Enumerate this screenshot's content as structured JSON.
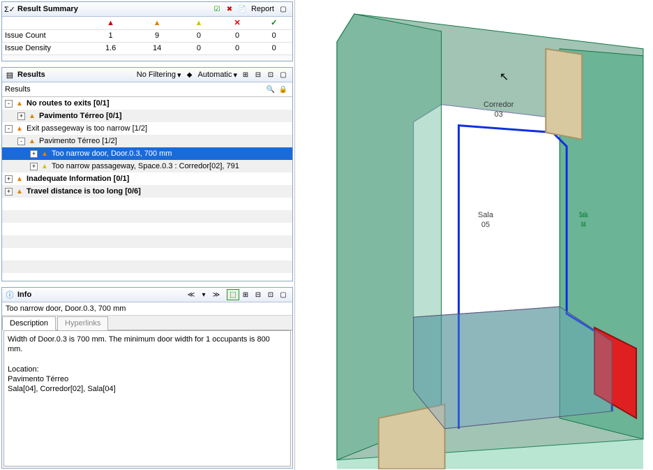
{
  "summary": {
    "title": "Result Summary",
    "report_label": "Report",
    "columns_icons": [
      "red",
      "orange",
      "yellow",
      "x",
      "check"
    ],
    "rows": [
      {
        "label": "Issue Count",
        "vals": [
          "1",
          "9",
          "0",
          "0",
          "0"
        ]
      },
      {
        "label": "Issue Density",
        "vals": [
          "1.6",
          "14",
          "0",
          "0",
          "0"
        ]
      }
    ]
  },
  "results": {
    "title": "Results",
    "filter_label": "No Filtering",
    "mode_label": "Automatic",
    "subheader": "Results",
    "tree": [
      {
        "depth": 0,
        "toggle": "-",
        "icon": "orange",
        "bold": true,
        "text": "No routes to exits [0/1]",
        "selected": false
      },
      {
        "depth": 1,
        "toggle": "+",
        "icon": "orange",
        "bold": true,
        "text": "Pavimento Térreo [0/1]",
        "selected": false
      },
      {
        "depth": 0,
        "toggle": "-",
        "icon": "orange",
        "bold": false,
        "text": "Exit passegeway is too narrow [1/2]",
        "selected": false
      },
      {
        "depth": 1,
        "toggle": "-",
        "icon": "orange",
        "bold": false,
        "text": "Pavimento Térreo [1/2]",
        "selected": false
      },
      {
        "depth": 2,
        "toggle": "+",
        "icon": "orange",
        "bold": false,
        "text": "Too narrow door, Door.0.3, 700 mm",
        "selected": true
      },
      {
        "depth": 2,
        "toggle": "+",
        "icon": "yellow",
        "bold": false,
        "text": "Too narrow passageway, Space.0.3 : Corredor[02], 791",
        "selected": false
      },
      {
        "depth": 0,
        "toggle": "+",
        "icon": "orange",
        "bold": true,
        "text": "Inadequate Information [0/1]",
        "selected": false
      },
      {
        "depth": 0,
        "toggle": "+",
        "icon": "orange",
        "bold": true,
        "text": "Travel distance is too long [0/6]",
        "selected": false
      }
    ]
  },
  "info": {
    "title": "Info",
    "issue_line": "Too narrow door, Door.0.3, 700 mm",
    "tab_description": "Description",
    "tab_hyperlinks": "Hyperlinks",
    "desc_line1": "Width of Door.0.3 is 700 mm. The minimum door width for 1 occupants is 800 mm.",
    "desc_loc_label": "Location:",
    "desc_loc1": "Pavimento Térreo",
    "desc_loc2": "Sala[04], Corredor[02], Sala[04]"
  },
  "view": {
    "label_corredor": "Corredor\n03",
    "label_sala05": "Sala\n05",
    "label_sala04": "Sala\n04"
  }
}
